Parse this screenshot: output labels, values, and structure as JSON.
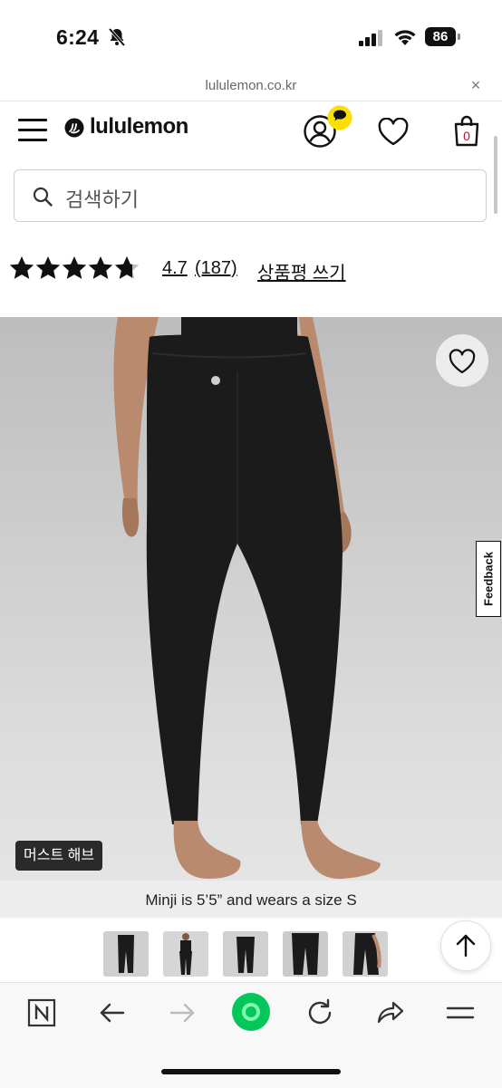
{
  "status_bar": {
    "time": "6:24",
    "battery": "86"
  },
  "browser": {
    "url": "lululemon.co.kr",
    "close_glyph": "×"
  },
  "header": {
    "brand": "lululemon",
    "cart_count": "0",
    "icons": [
      "menu-icon",
      "lululemon-logo-icon",
      "account-icon",
      "chat-icon",
      "wishlist-heart-icon",
      "shopping-bag-icon"
    ]
  },
  "search": {
    "placeholder": "검색하기"
  },
  "rating": {
    "stars": 4.7,
    "max_stars": 5,
    "value": "4.7",
    "count": "(187)",
    "write_review": "상품평 쓰기"
  },
  "product_image": {
    "tag": "머스트 해브",
    "caption": "Minji is 5’5” and wears a size S",
    "feedback_label": "Feedback"
  },
  "thumbnails": {
    "count": 5
  },
  "colors": {
    "chat_badge": "#f9e000",
    "text": "#111111",
    "cart_count": "#c8102e",
    "naver_green": "#03c75a"
  }
}
